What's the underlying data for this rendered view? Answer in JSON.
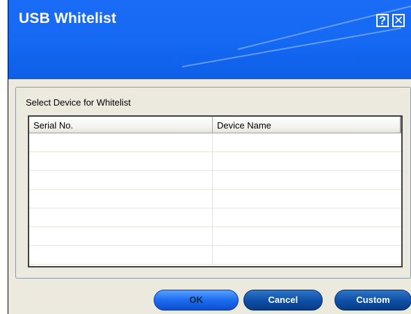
{
  "window": {
    "title": "USB Whitelist",
    "help_glyph": "?",
    "close_glyph": "✕"
  },
  "group": {
    "label": "Select Device for Whitelist"
  },
  "table": {
    "columns": [
      "Serial No.",
      "Device Name"
    ],
    "rows": [
      [
        "",
        ""
      ],
      [
        "",
        ""
      ],
      [
        "",
        ""
      ],
      [
        "",
        ""
      ],
      [
        "",
        ""
      ],
      [
        "",
        ""
      ],
      [
        "",
        ""
      ]
    ]
  },
  "buttons": {
    "ok": "OK",
    "cancel": "Cancel",
    "custom": "Custom"
  },
  "colors": {
    "titlebar": "#1569f2",
    "button": "#0d4fa6",
    "dialog_bg": "#ece9df"
  }
}
